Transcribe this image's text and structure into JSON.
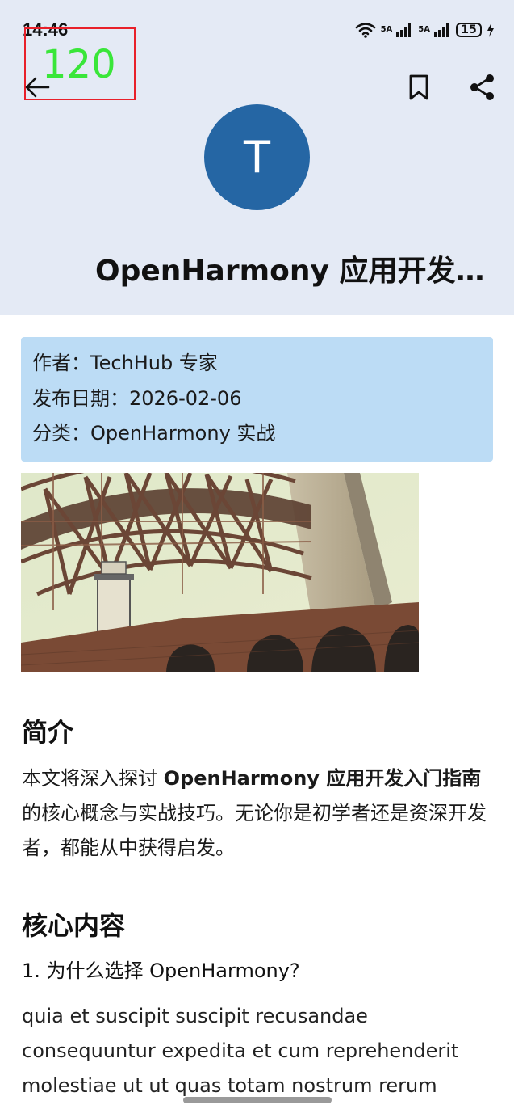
{
  "status_bar": {
    "time": "14:46",
    "network_label_1": "5A",
    "network_label_2": "5A",
    "battery": "15"
  },
  "debug_counter": "120",
  "header": {
    "avatar_letter": "T",
    "title": "OpenHarmony 应用开发入门指南"
  },
  "meta": {
    "author": "作者：TechHub 专家",
    "date": "发布日期：2026-02-06",
    "category": "分类：OpenHarmony 实战"
  },
  "intro": {
    "heading": "简介",
    "text_before": "本文将深入探讨 ",
    "text_bold": "OpenHarmony 应用开发入门指南",
    "text_after": " 的核心概念与实战技巧。无论你是初学者还是资深开发者，都能从中获得启发。"
  },
  "core": {
    "heading": "核心内容",
    "subheading": "1. 为什么选择 OpenHarmony?",
    "body": "quia et suscipit suscipit recusandae consequuntur expedita et cum reprehenderit molestiae ut ut quas totam nostrum rerum"
  },
  "colors": {
    "header_bg": "#e4eaf5",
    "avatar": "#2566a4",
    "meta_card": "#bcdcf5",
    "debug_border": "#e8202a",
    "debug_text": "#39e639"
  },
  "icons": [
    "back-arrow-icon",
    "bookmark-icon",
    "share-icon",
    "wifi-icon",
    "signal-icon",
    "battery-icon",
    "charging-icon"
  ]
}
